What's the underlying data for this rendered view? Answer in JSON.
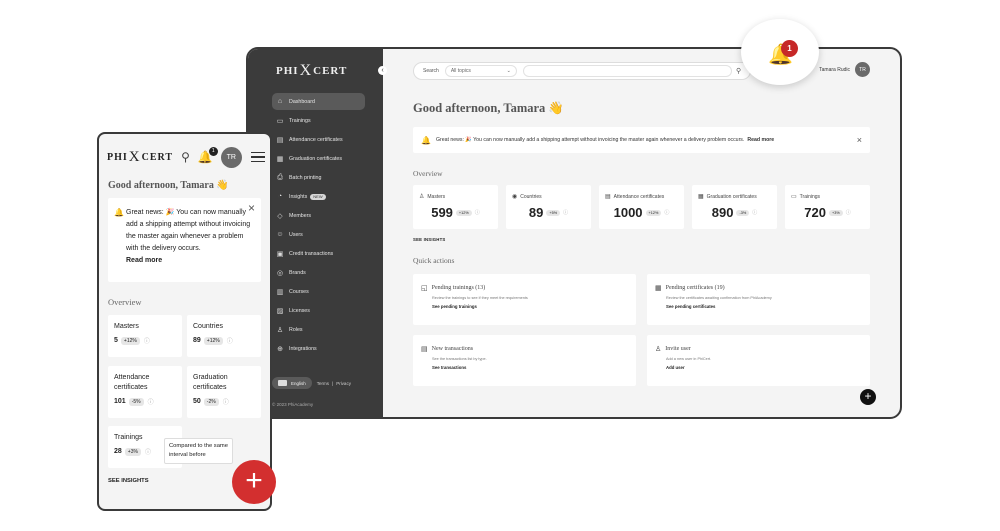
{
  "brand": {
    "left": "PHI",
    "mark": "X",
    "right": "CERT"
  },
  "desktop": {
    "nav": [
      {
        "icon": "⌂",
        "label": "Dashboard"
      },
      {
        "icon": "▭",
        "label": "Trainings"
      },
      {
        "icon": "▤",
        "label": "Attendance certificates"
      },
      {
        "icon": "▦",
        "label": "Graduation certificates"
      },
      {
        "icon": "⎙",
        "label": "Batch printing"
      },
      {
        "icon": "◔",
        "label": "Insights",
        "badge": "NEW"
      },
      {
        "icon": "◇",
        "label": "Members"
      },
      {
        "icon": "☺",
        "label": "Users"
      },
      {
        "icon": "▣",
        "label": "Credit transactions"
      },
      {
        "icon": "◎",
        "label": "Brands"
      },
      {
        "icon": "▥",
        "label": "Courses"
      },
      {
        "icon": "▨",
        "label": "Licenses"
      },
      {
        "icon": "♙",
        "label": "Roles"
      },
      {
        "icon": "⊕",
        "label": "Integrations"
      }
    ],
    "language": "English",
    "terms": "Terms",
    "privacy": "Privacy",
    "copyright": "© 2023 PhiAcademy",
    "search": {
      "label": "Search",
      "topic": "All topics"
    },
    "user_name": "Tamara Rudic",
    "user_initials": "TR",
    "greeting": "Good afternoon, Tamara 👋",
    "banner": {
      "text": "Great news: 🎉 You can now manually add a shipping attempt without invoicing the master again whenever a delivery problem occurs.",
      "link": "Read more"
    },
    "overview_title": "Overview",
    "stats": [
      {
        "icon": "♙",
        "label": "Masters",
        "value": "599",
        "change": "+12%"
      },
      {
        "icon": "◉",
        "label": "Countries",
        "value": "89",
        "change": "+5%"
      },
      {
        "icon": "▤",
        "label": "Attendance certificates",
        "value": "1000",
        "change": "+12%"
      },
      {
        "icon": "▦",
        "label": "Graduation certificates",
        "value": "890",
        "change": "-3%"
      },
      {
        "icon": "▭",
        "label": "Trainings",
        "value": "720",
        "change": "+3%"
      }
    ],
    "see_insights": "SEE INSIGHTS",
    "quick_title": "Quick actions",
    "quick": [
      {
        "icon": "◱",
        "title": "Pending trainings (13)",
        "desc": "Review the trainings to see if they meet the requirements",
        "link": "See pending trainings"
      },
      {
        "icon": "▦",
        "title": "Pending certificates (19)",
        "desc": "Review the certificates awaiting confirmation from PhiAcademy",
        "link": "See pending certificates"
      },
      {
        "icon": "▤",
        "title": "New transactions",
        "desc": "See the transactions list by type.",
        "link": "See transactions"
      },
      {
        "icon": "♙",
        "title": "Invite user",
        "desc": "Add a new user in PhiCert.",
        "link": "Add user"
      }
    ],
    "notification_count": "1"
  },
  "mobile": {
    "greeting": "Good afternoon, Tamara 👋",
    "user_initials": "TR",
    "notification_count": "1",
    "banner": {
      "text": "Great news: 🎉 You can now manually add a shipping attempt without invoicing the master again whenever a problem with the delivery occurs.",
      "link": "Read more"
    },
    "overview_title": "Overview",
    "stats": [
      {
        "label": "Masters",
        "value": "5",
        "change": "+12%"
      },
      {
        "label": "Countries",
        "value": "89",
        "change": "+12%"
      },
      {
        "label": "Attendance certificates",
        "value": "101",
        "change": "-5%"
      },
      {
        "label": "Graduation certificates",
        "value": "50",
        "change": "-2%"
      },
      {
        "label": "Trainings",
        "value": "28",
        "change": "+3%"
      }
    ],
    "tooltip": "Compared to the same interval before",
    "see_insights": "SEE INSIGHTS"
  }
}
